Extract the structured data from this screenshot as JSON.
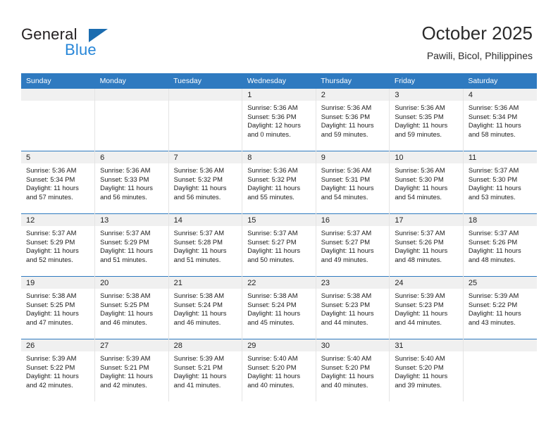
{
  "brand": {
    "name_top": "General",
    "name_bottom": "Blue",
    "logo_icon": "triangle-icon",
    "accent_color": "#2786d8",
    "triangle_color": "#1b6cb0"
  },
  "header": {
    "title": "October 2025",
    "subtitle": "Pawili, Bicol, Philippines"
  },
  "calendar": {
    "header_bg": "#2f7ac0",
    "header_text_color": "#ffffff",
    "daynum_band_bg": "#f0f0f0",
    "columns": [
      "Sunday",
      "Monday",
      "Tuesday",
      "Wednesday",
      "Thursday",
      "Friday",
      "Saturday"
    ],
    "weeks": [
      [
        {
          "day": "",
          "lines": []
        },
        {
          "day": "",
          "lines": []
        },
        {
          "day": "",
          "lines": []
        },
        {
          "day": "1",
          "lines": [
            "Sunrise: 5:36 AM",
            "Sunset: 5:36 PM",
            "Daylight: 12 hours",
            "and 0 minutes."
          ]
        },
        {
          "day": "2",
          "lines": [
            "Sunrise: 5:36 AM",
            "Sunset: 5:36 PM",
            "Daylight: 11 hours",
            "and 59 minutes."
          ]
        },
        {
          "day": "3",
          "lines": [
            "Sunrise: 5:36 AM",
            "Sunset: 5:35 PM",
            "Daylight: 11 hours",
            "and 59 minutes."
          ]
        },
        {
          "day": "4",
          "lines": [
            "Sunrise: 5:36 AM",
            "Sunset: 5:34 PM",
            "Daylight: 11 hours",
            "and 58 minutes."
          ]
        }
      ],
      [
        {
          "day": "5",
          "lines": [
            "Sunrise: 5:36 AM",
            "Sunset: 5:34 PM",
            "Daylight: 11 hours",
            "and 57 minutes."
          ]
        },
        {
          "day": "6",
          "lines": [
            "Sunrise: 5:36 AM",
            "Sunset: 5:33 PM",
            "Daylight: 11 hours",
            "and 56 minutes."
          ]
        },
        {
          "day": "7",
          "lines": [
            "Sunrise: 5:36 AM",
            "Sunset: 5:32 PM",
            "Daylight: 11 hours",
            "and 56 minutes."
          ]
        },
        {
          "day": "8",
          "lines": [
            "Sunrise: 5:36 AM",
            "Sunset: 5:32 PM",
            "Daylight: 11 hours",
            "and 55 minutes."
          ]
        },
        {
          "day": "9",
          "lines": [
            "Sunrise: 5:36 AM",
            "Sunset: 5:31 PM",
            "Daylight: 11 hours",
            "and 54 minutes."
          ]
        },
        {
          "day": "10",
          "lines": [
            "Sunrise: 5:36 AM",
            "Sunset: 5:30 PM",
            "Daylight: 11 hours",
            "and 54 minutes."
          ]
        },
        {
          "day": "11",
          "lines": [
            "Sunrise: 5:37 AM",
            "Sunset: 5:30 PM",
            "Daylight: 11 hours",
            "and 53 minutes."
          ]
        }
      ],
      [
        {
          "day": "12",
          "lines": [
            "Sunrise: 5:37 AM",
            "Sunset: 5:29 PM",
            "Daylight: 11 hours",
            "and 52 minutes."
          ]
        },
        {
          "day": "13",
          "lines": [
            "Sunrise: 5:37 AM",
            "Sunset: 5:29 PM",
            "Daylight: 11 hours",
            "and 51 minutes."
          ]
        },
        {
          "day": "14",
          "lines": [
            "Sunrise: 5:37 AM",
            "Sunset: 5:28 PM",
            "Daylight: 11 hours",
            "and 51 minutes."
          ]
        },
        {
          "day": "15",
          "lines": [
            "Sunrise: 5:37 AM",
            "Sunset: 5:27 PM",
            "Daylight: 11 hours",
            "and 50 minutes."
          ]
        },
        {
          "day": "16",
          "lines": [
            "Sunrise: 5:37 AM",
            "Sunset: 5:27 PM",
            "Daylight: 11 hours",
            "and 49 minutes."
          ]
        },
        {
          "day": "17",
          "lines": [
            "Sunrise: 5:37 AM",
            "Sunset: 5:26 PM",
            "Daylight: 11 hours",
            "and 48 minutes."
          ]
        },
        {
          "day": "18",
          "lines": [
            "Sunrise: 5:37 AM",
            "Sunset: 5:26 PM",
            "Daylight: 11 hours",
            "and 48 minutes."
          ]
        }
      ],
      [
        {
          "day": "19",
          "lines": [
            "Sunrise: 5:38 AM",
            "Sunset: 5:25 PM",
            "Daylight: 11 hours",
            "and 47 minutes."
          ]
        },
        {
          "day": "20",
          "lines": [
            "Sunrise: 5:38 AM",
            "Sunset: 5:25 PM",
            "Daylight: 11 hours",
            "and 46 minutes."
          ]
        },
        {
          "day": "21",
          "lines": [
            "Sunrise: 5:38 AM",
            "Sunset: 5:24 PM",
            "Daylight: 11 hours",
            "and 46 minutes."
          ]
        },
        {
          "day": "22",
          "lines": [
            "Sunrise: 5:38 AM",
            "Sunset: 5:24 PM",
            "Daylight: 11 hours",
            "and 45 minutes."
          ]
        },
        {
          "day": "23",
          "lines": [
            "Sunrise: 5:38 AM",
            "Sunset: 5:23 PM",
            "Daylight: 11 hours",
            "and 44 minutes."
          ]
        },
        {
          "day": "24",
          "lines": [
            "Sunrise: 5:39 AM",
            "Sunset: 5:23 PM",
            "Daylight: 11 hours",
            "and 44 minutes."
          ]
        },
        {
          "day": "25",
          "lines": [
            "Sunrise: 5:39 AM",
            "Sunset: 5:22 PM",
            "Daylight: 11 hours",
            "and 43 minutes."
          ]
        }
      ],
      [
        {
          "day": "26",
          "lines": [
            "Sunrise: 5:39 AM",
            "Sunset: 5:22 PM",
            "Daylight: 11 hours",
            "and 42 minutes."
          ]
        },
        {
          "day": "27",
          "lines": [
            "Sunrise: 5:39 AM",
            "Sunset: 5:21 PM",
            "Daylight: 11 hours",
            "and 42 minutes."
          ]
        },
        {
          "day": "28",
          "lines": [
            "Sunrise: 5:39 AM",
            "Sunset: 5:21 PM",
            "Daylight: 11 hours",
            "and 41 minutes."
          ]
        },
        {
          "day": "29",
          "lines": [
            "Sunrise: 5:40 AM",
            "Sunset: 5:20 PM",
            "Daylight: 11 hours",
            "and 40 minutes."
          ]
        },
        {
          "day": "30",
          "lines": [
            "Sunrise: 5:40 AM",
            "Sunset: 5:20 PM",
            "Daylight: 11 hours",
            "and 40 minutes."
          ]
        },
        {
          "day": "31",
          "lines": [
            "Sunrise: 5:40 AM",
            "Sunset: 5:20 PM",
            "Daylight: 11 hours",
            "and 39 minutes."
          ]
        },
        {
          "day": "",
          "lines": []
        }
      ]
    ]
  }
}
